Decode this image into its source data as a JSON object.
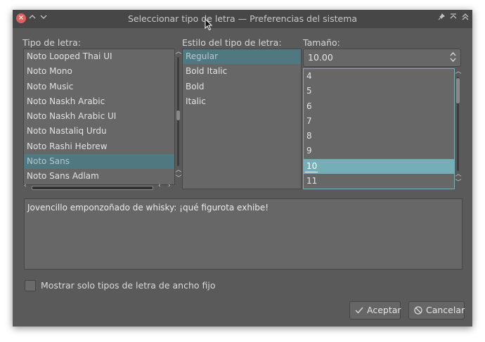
{
  "window": {
    "title": "Seleccionar tipo de letra — Preferencias del sistema",
    "titlebar_icons": [
      "close-icon",
      "chevron-up-icon",
      "chevron-down-icon",
      "pin-icon",
      "keep-above-icon",
      "keep-below-icon"
    ]
  },
  "font_family": {
    "label": "Tipo de letra:",
    "items": [
      "Noto Looped Thai UI",
      "Noto Mono",
      "Noto Music",
      "Noto Naskh Arabic",
      "Noto Naskh Arabic UI",
      "Noto Nastaliq Urdu",
      "Noto Rashi Hebrew",
      "Noto Sans",
      "Noto Sans Adlam"
    ],
    "selected": "Noto Sans"
  },
  "font_style": {
    "label": "Estilo del tipo de letra:",
    "items": [
      "Regular",
      "Bold Italic",
      "Bold",
      "Italic"
    ],
    "selected": "Regular"
  },
  "font_size": {
    "label": "Tamaño:",
    "value": "10.00",
    "items": [
      "4",
      "5",
      "6",
      "7",
      "8",
      "9",
      "10",
      "11"
    ],
    "selected": "10"
  },
  "preview": {
    "text": "Jovencillo emponzoñado de whisky: ¡qué figurota exhibe!"
  },
  "fixed_width": {
    "label": "Mostrar solo tipos de letra de ancho fijo",
    "checked": false
  },
  "buttons": {
    "accept": "Aceptar",
    "cancel": "Cancelar"
  },
  "colors": {
    "window_bg": "#5a5a5a",
    "titlebar_bg": "#474747",
    "selection": "#4f7880",
    "highlight": "#75aeb6",
    "close_button": "#e0605d"
  }
}
